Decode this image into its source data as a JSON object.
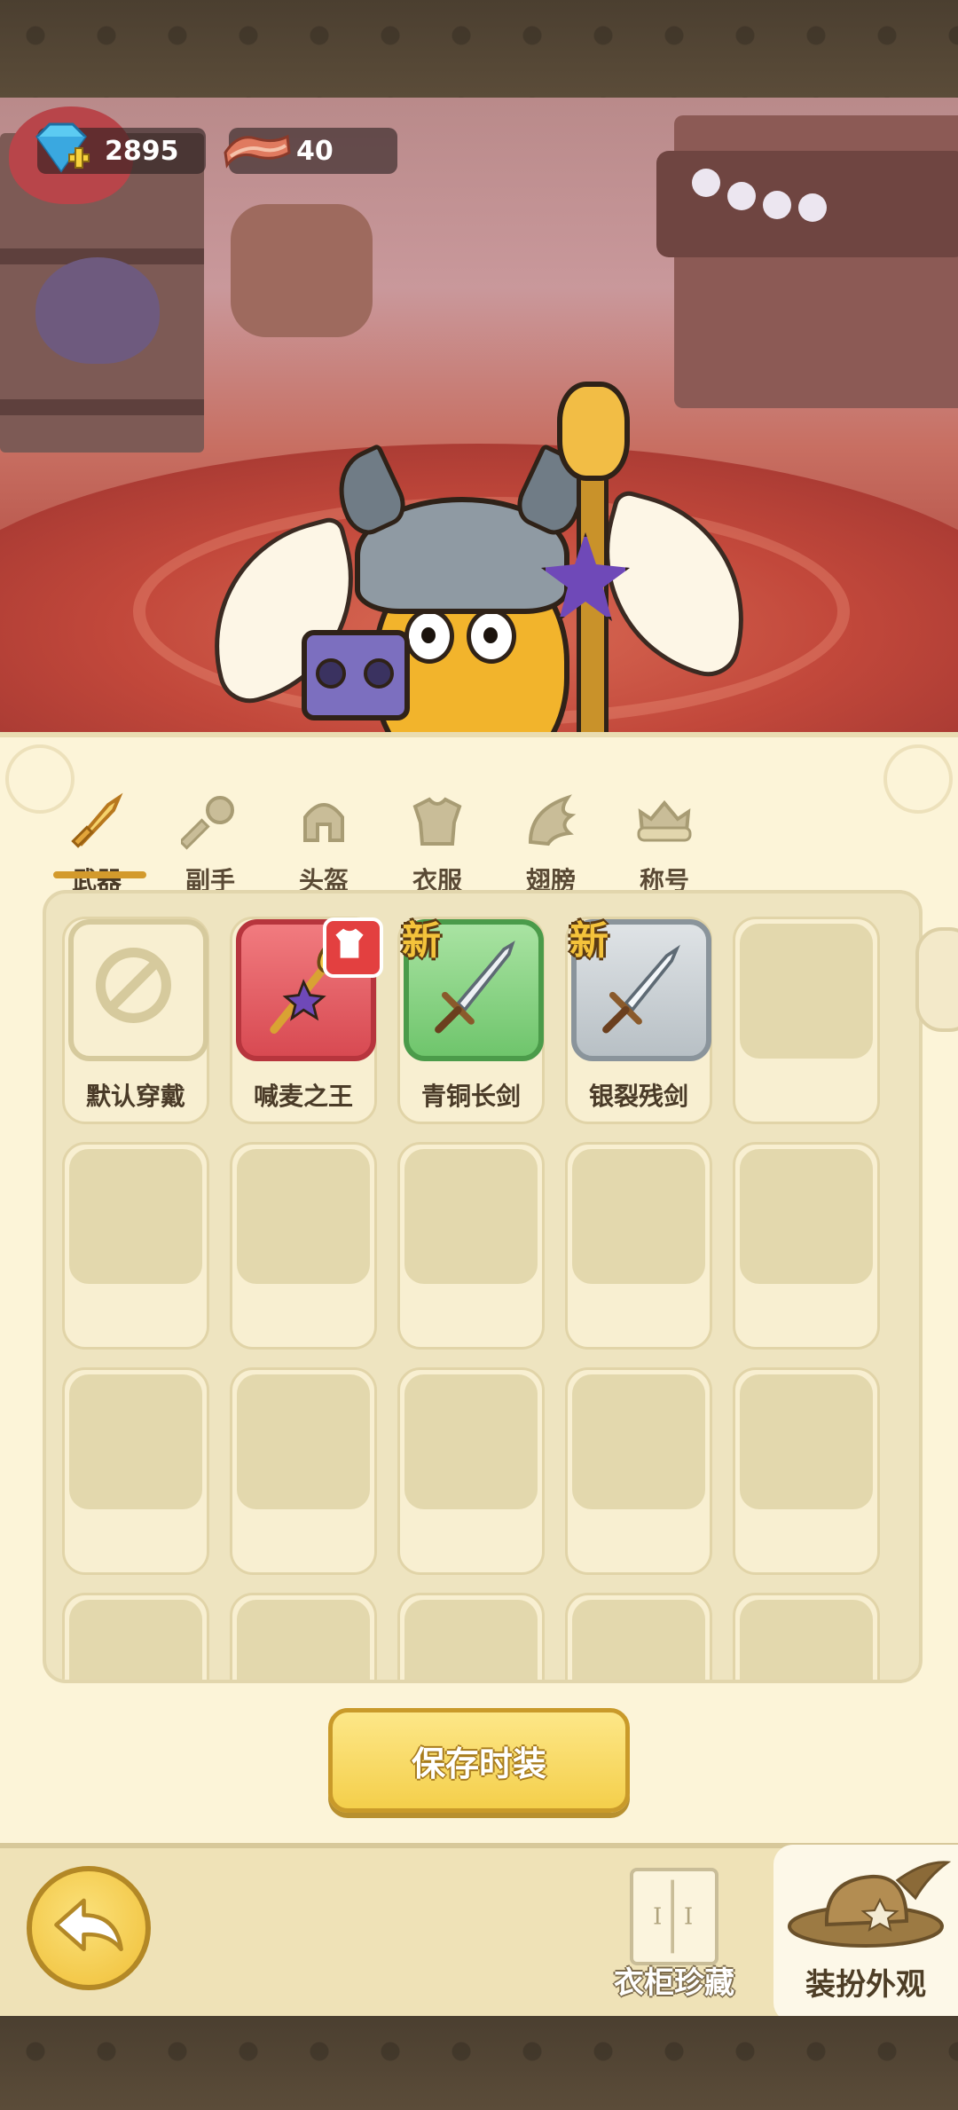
{
  "currency": {
    "gems": "2895",
    "bacon": "40"
  },
  "tabs": [
    {
      "label": "武器",
      "icon": "sword-icon",
      "active": true
    },
    {
      "label": "副手",
      "icon": "offhand-icon",
      "active": false
    },
    {
      "label": "头盔",
      "icon": "helmet-icon",
      "active": false
    },
    {
      "label": "衣服",
      "icon": "armor-icon",
      "active": false
    },
    {
      "label": "翅膀",
      "icon": "wings-icon",
      "active": false
    },
    {
      "label": "称号",
      "icon": "title-badge-icon",
      "active": false
    }
  ],
  "items": [
    {
      "label": "默认穿戴",
      "icon": "prohibited-icon",
      "style": "default",
      "badge": ""
    },
    {
      "label": "喊麦之王",
      "icon": "mic-staff-icon",
      "style": "red",
      "badge": "shirt-icon"
    },
    {
      "label": "青铜长剑",
      "icon": "bronze-sword-icon",
      "style": "green",
      "badge": "新"
    },
    {
      "label": "银裂残剑",
      "icon": "silver-sword-icon",
      "style": "gray",
      "badge": "新"
    }
  ],
  "save_button": "保存时装",
  "bottom": {
    "wardrobe_label": "衣柜珍藏",
    "dress_label": "装扮外观"
  },
  "colors": {
    "accent_yellow": "#f4cf4b",
    "panel_bg": "#fcf4d8",
    "tab_underline": "#d39a2c",
    "new_tag": "#f4c33b"
  }
}
